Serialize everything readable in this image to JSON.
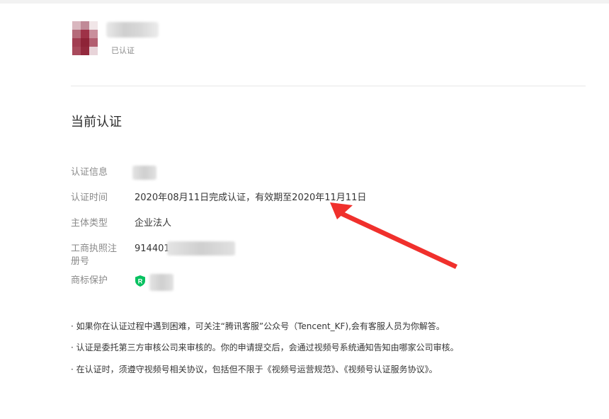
{
  "account": {
    "status": "已认证"
  },
  "section": {
    "title": "当前认证"
  },
  "fields": {
    "info_label": "认证信息",
    "time_label": "认证时间",
    "time_value": "2020年08月11日完成认证，有效期至2020年11月11日",
    "type_label": "主体类型",
    "type_value": "企业法人",
    "reg_label": "工商执照注册号",
    "reg_value": "914401",
    "trademark_label": "商标保护",
    "trademark_badge": "R"
  },
  "notes": [
    "· 如果你在认证过程中遇到困难，可关注“腾讯客服”公众号（Tencent_KF),会有客服人员为你解答。",
    "· 认证是委托第三方审核公司来审核的。你的申请提交后，会通过视频号系统通知告知由哪家公司审核。",
    "· 在认证时，须遵守视频号相关协议，包括但不限于《视频号运营规范》、《视频号认证服务协议》。"
  ],
  "colors": {
    "accent_green": "#07c160",
    "annotation_red": "#f0302c",
    "label_gray": "#8a8a8a"
  },
  "icons": {
    "trademark": "shield-r-icon",
    "annotation": "red-arrow"
  }
}
